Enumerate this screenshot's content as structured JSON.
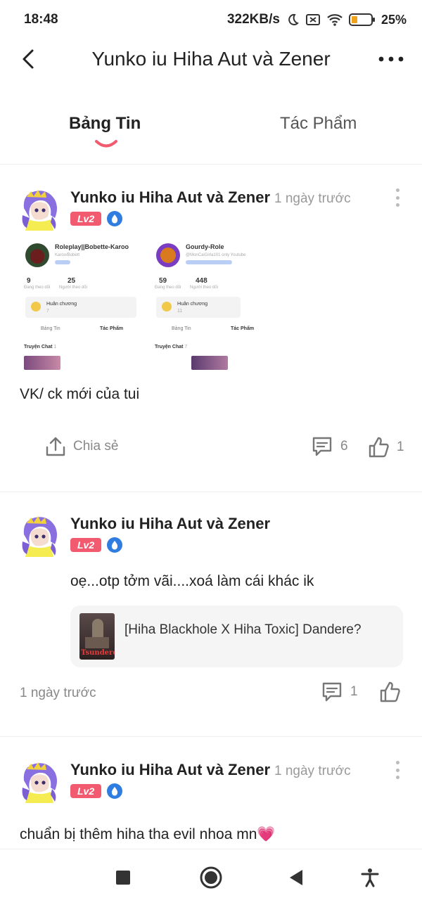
{
  "status_bar": {
    "time": "18:48",
    "speed": "322KB/s",
    "battery": "25%"
  },
  "header": {
    "title": "Yunko iu Hiha Aut và Zener"
  },
  "tabs": [
    {
      "label": "Bảng Tin",
      "active": true
    },
    {
      "label": "Tác Phẩm",
      "active": false
    }
  ],
  "posts": [
    {
      "author": "Yunko iu Hiha Aut và Zener",
      "time": "1 ngày trước",
      "level": "Lv2",
      "text": "VK/ ck mới của tui",
      "share_label": "Chia sẻ",
      "comments": "6",
      "likes": "1",
      "screenshot": {
        "left": {
          "name": "Roleplay||Bobette-Karoo",
          "sub": "Karoo/Bobett",
          "following": "9",
          "following_label": "Đang theo dõi",
          "followers": "25",
          "followers_label": "Người theo dõi",
          "medal": "Huân chương",
          "medal_count": "7",
          "tab1": "Bảng Tin",
          "tab2": "Tác Phẩm",
          "chat": "Truyện Chat",
          "chat_count": "1"
        },
        "right": {
          "name": "Gourdy-Role",
          "sub": "@MonCaiGirla101 only Youtube",
          "following": "59",
          "following_label": "Đang theo dõi",
          "followers": "448",
          "followers_label": "Người theo dõi",
          "medal": "Huân chương",
          "medal_count": "11",
          "tab1": "Bảng Tin",
          "tab2": "Tác Phẩm",
          "chat": "Truyện Chat",
          "chat_count": "7"
        }
      }
    },
    {
      "author": "Yunko iu Hiha Aut và Zener",
      "level": "Lv2",
      "text": "oẹ...otp tởm vãi....xoá làm cái khác ik",
      "link_title": "[Hiha Blackhole X Hiha Toxic] Dandere?",
      "link_thumb_text": "Tsundere?",
      "time": "1 ngày trước",
      "comments": "1"
    },
    {
      "author": "Yunko iu Hiha Aut và Zener",
      "time": "1 ngày trước",
      "level": "Lv2",
      "text": "chuẩn bị thêm hiha tha evil nhoa mn💗"
    }
  ],
  "colors": {
    "accent": "#f25a70",
    "badge_blue": "#2f7de1",
    "muted": "#999999"
  },
  "icons": [
    "back-icon",
    "more-icon",
    "share-icon",
    "comment-icon",
    "like-icon",
    "kebab-icon",
    "drop-badge-icon",
    "recent-apps-icon",
    "home-icon",
    "back-nav-icon",
    "accessibility-icon"
  ]
}
